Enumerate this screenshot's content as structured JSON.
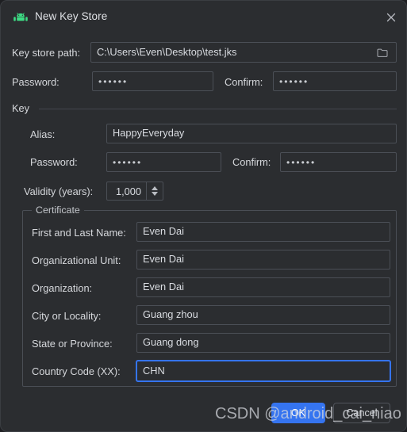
{
  "window": {
    "title": "New Key Store",
    "app_icon": "android-robot-icon",
    "close_icon": "close-icon",
    "accent_color": "#3574F0",
    "background_color": "#2B2D30",
    "field_border_color": "#4B4F56",
    "android_icon_color": "#3DDC84"
  },
  "keystore": {
    "path_label": "Key store path:",
    "path_value": "C:\\Users\\Even\\Desktop\\test.jks",
    "browse_icon": "folder-icon",
    "password_label": "Password:",
    "password_value": "••••••",
    "confirm_label": "Confirm:",
    "confirm_value": "••••••"
  },
  "key_section": {
    "title": "Key",
    "alias_label": "Alias:",
    "alias_value": "HappyEveryday",
    "password_label": "Password:",
    "password_value": "••••••",
    "confirm_label": "Confirm:",
    "confirm_value": "••••••",
    "validity_label": "Validity (years):",
    "validity_value": "1,000"
  },
  "certificate": {
    "legend": "Certificate",
    "rows": [
      {
        "label": "First and Last Name:",
        "value": "Even Dai",
        "focused": false
      },
      {
        "label": "Organizational Unit:",
        "value": "Even Dai",
        "focused": false
      },
      {
        "label": "Organization:",
        "value": "Even Dai",
        "focused": false
      },
      {
        "label": "City or Locality:",
        "value": "Guang zhou",
        "focused": false
      },
      {
        "label": "State or Province:",
        "value": "Guang dong",
        "focused": false
      },
      {
        "label": "Country Code (XX):",
        "value": "CHN",
        "focused": true
      }
    ]
  },
  "footer": {
    "ok_label": "OK",
    "cancel_label": "Cancel"
  },
  "watermark": {
    "text": "CSDN @android_cai_niao"
  }
}
